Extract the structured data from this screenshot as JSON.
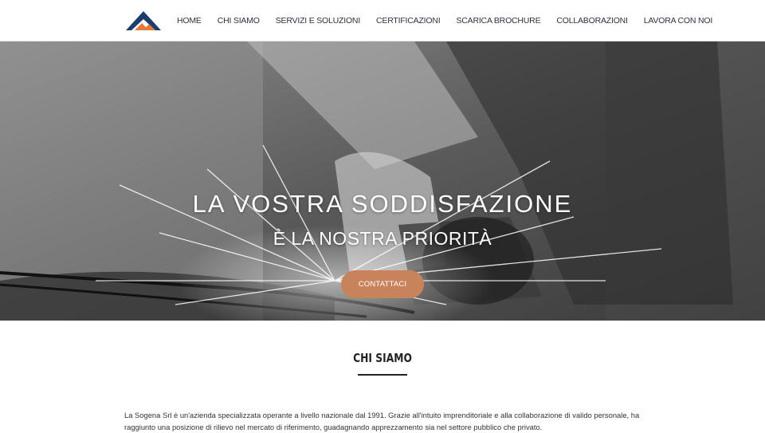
{
  "nav": {
    "logo_icon": "mountain-logo",
    "items": [
      {
        "label": "HOME"
      },
      {
        "label": "CHI SIAMO"
      },
      {
        "label": "SERVIZI E SOLUZIONI"
      },
      {
        "label": "CERTIFICAZIONI"
      },
      {
        "label": "SCARICA BROCHURE"
      },
      {
        "label": "COLLABORAZIONI"
      },
      {
        "label": "LAVORA CON NOI"
      }
    ]
  },
  "hero": {
    "title": "LA VOSTRA SODDISFAZIONE",
    "subtitle": "È LA NOSTRA PRIORITÀ",
    "cta_label": "CONTATTACI"
  },
  "about": {
    "title": "CHI SIAMO",
    "text": "La Sogena Srl è un'azienda specializzata operante a livello nazionale dal 1991. Grazie all'intuito imprenditoriale e alla collaborazione di valido personale, ha raggiunto una posizione di rilievo nel mercato di riferimento, guadagnando apprezzamento sia nel settore pubblico che privato."
  },
  "colors": {
    "accent": "#c9835a",
    "logo_blue": "#1f3d6b",
    "logo_orange": "#e07b3c",
    "nav_text": "#2e3240"
  }
}
